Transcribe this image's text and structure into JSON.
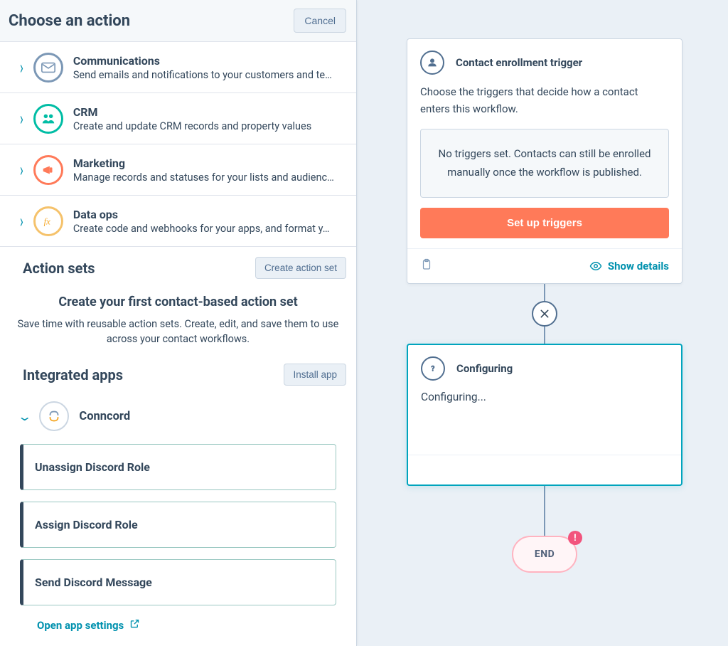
{
  "panel": {
    "title": "Choose an action",
    "cancel_label": "Cancel"
  },
  "categories": [
    {
      "title": "Communications",
      "desc": "Send emails and notifications to your customers and te…"
    },
    {
      "title": "CRM",
      "desc": "Create and update CRM records and property values"
    },
    {
      "title": "Marketing",
      "desc": "Manage records and statuses for your lists and audienc…"
    },
    {
      "title": "Data ops",
      "desc": "Create code and webhooks for your apps, and format y…"
    }
  ],
  "action_sets": {
    "heading": "Action sets",
    "create_label": "Create action set",
    "promo_title": "Create your first contact-based action set",
    "promo_desc": "Save time with reusable action sets. Create, edit, and save them to use across your contact workflows."
  },
  "integrated": {
    "heading": "Integrated apps",
    "install_label": "Install app",
    "app_name": "Conncord",
    "actions": [
      "Unassign Discord Role",
      "Assign Discord Role",
      "Send Discord Message"
    ],
    "settings_link": "Open app settings"
  },
  "canvas": {
    "trigger_title": "Contact enrollment trigger",
    "trigger_desc": "Choose the triggers that decide how a contact enters this workflow.",
    "no_triggers": "No triggers set. Contacts can still be enrolled manually once the workflow is published.",
    "setup_label": "Set up triggers",
    "show_details": "Show details",
    "config_title": "Configuring",
    "config_body": "Configuring...",
    "end_label": "END"
  }
}
